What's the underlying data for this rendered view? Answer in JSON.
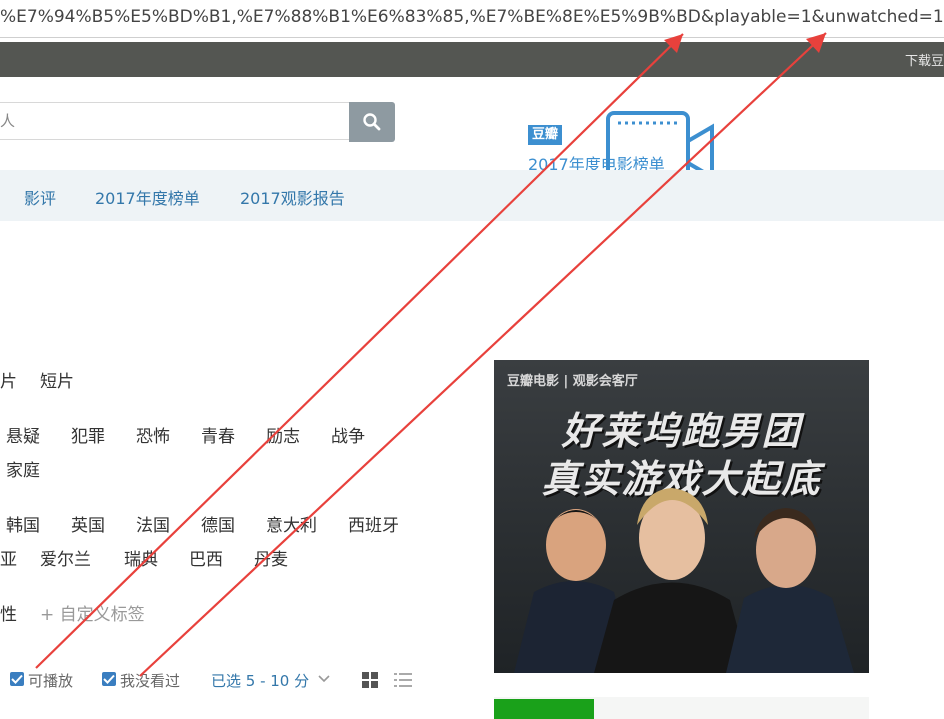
{
  "browser": {
    "url_text": "%E7%94%B5%E5%BD%B1,%E7%88%B1%E6%83%85,%E7%BE%8E%E5%9B%BD&playable=1&unwatched=1"
  },
  "topbar": {
    "download_text": "下载豆"
  },
  "search": {
    "placeholder_text": "人"
  },
  "promo": {
    "badge": "豆瓣",
    "title": "2017年度电影榜单"
  },
  "nav": {
    "items": [
      "影评",
      "2017年度榜单",
      "2017观影报告"
    ]
  },
  "tags": {
    "row1": [
      "片",
      "短片"
    ],
    "row2": [
      "悬疑",
      "犯罪",
      "恐怖",
      "青春",
      "励志",
      "战争"
    ],
    "row3": [
      "家庭"
    ],
    "row4": [
      "韩国",
      "英国",
      "法国",
      "德国",
      "意大利",
      "西班牙"
    ],
    "row5": [
      "亚",
      "爱尔兰",
      "瑞典",
      "巴西",
      "丹麦"
    ],
    "row6": [
      "性"
    ],
    "custom": "+ 自定义标签"
  },
  "filters": {
    "playable_label": "可播放",
    "unwatched_label": "我没看过",
    "rating_range": "已选 5 - 10 分"
  },
  "poster": {
    "brand": "豆瓣电影 | 观影会客厅",
    "headline_1": "好莱坞跑男团",
    "headline_2": "真实游戏大起底"
  },
  "colors": {
    "accent": "#3377aa",
    "annotation_arrow": "#e8413c",
    "checkbox": "#3a7ec0"
  },
  "icons": [
    "search-icon",
    "checkbox-checked-icon",
    "chevron-down-icon",
    "grid-view-icon",
    "list-view-icon",
    "camera-icon"
  ]
}
